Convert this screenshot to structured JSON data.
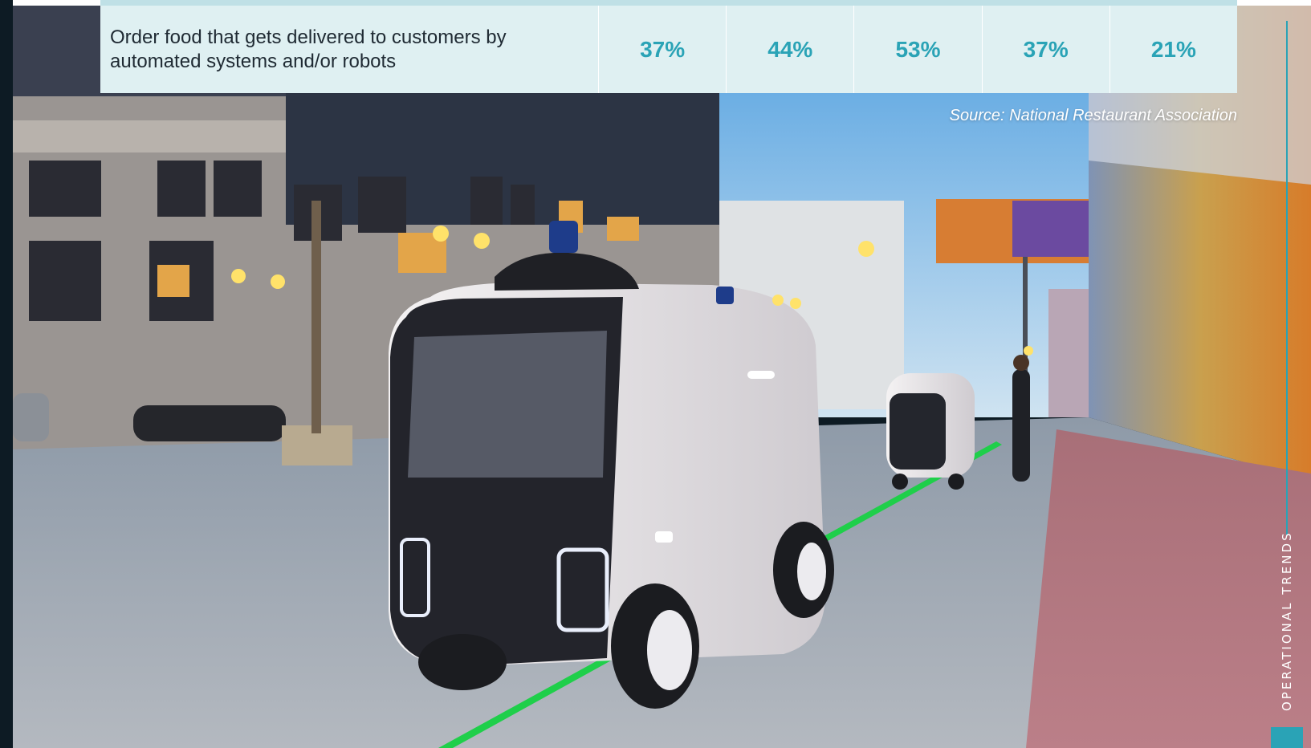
{
  "table": {
    "row_label": "Order food that gets delivered to customers by automated systems and/or robots",
    "values": [
      "37%",
      "44%",
      "53%",
      "37%",
      "21%"
    ]
  },
  "source_note": "Source: National Restaurant Association",
  "section_label": "OPERATIONAL TRENDS",
  "colors": {
    "accent": "#2aa3b6",
    "table_row_bg": "#dff0f2",
    "table_header_bar": "#bfe0e6",
    "label_text": "#1f2a33"
  }
}
